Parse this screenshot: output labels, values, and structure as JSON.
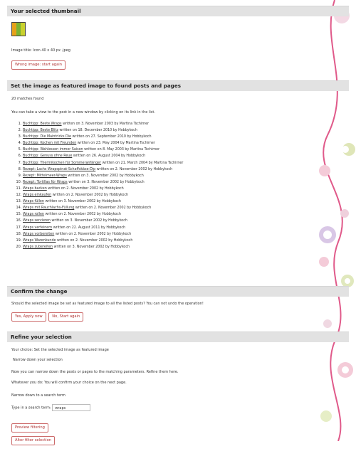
{
  "sections": {
    "thumbnail": {
      "title": "Your selected thumbnail",
      "image_title": "Image title: Icon 40 x 40 px .jpeg",
      "wrong_image_button": "Wrong image: start again"
    },
    "featured": {
      "title": "Set the image as featured image to found posts and pages",
      "matches": "20 matches found",
      "hint": "You can take a view to the post in a new window by clicking on its link in the list.",
      "posts": [
        {
          "link": "Buchtipp: Beste Wraps",
          "meta": "written on 3. November 2003 by Martina Tschirner"
        },
        {
          "link": "Buchtipp: Beste Blitz",
          "meta": "written on 18. December 2010 by Hobbykoch"
        },
        {
          "link": "Buchtipp: Die Maintricks Die",
          "meta": "written on 27. September 2010 by Hobbykoch"
        },
        {
          "link": "Buchtipp: Kochen mit Freunden",
          "meta": "written on 23. May 2004 by Martina Tschirner"
        },
        {
          "link": "Buchtipp: Wahlessen immer Saison",
          "meta": "written on 8. May 2003 by Martina Tschirner"
        },
        {
          "link": "Buchtipp: Genuss ohne Reue",
          "meta": "written on 26. August 2004 by Hobbykoch"
        },
        {
          "link": "Buchtipp: Thermikochen für Sommeranfänger",
          "meta": "written on 21. March 2004 by Martina Tschirner"
        },
        {
          "link": "Rezept: Lachs Wrapspinat-Schaffskäse-Dip",
          "meta": "written on 2. November 2002 by Hobbykoch"
        },
        {
          "link": "Rezept: Mittelmeer-Wraps",
          "meta": "written on 3. November 2002 by Hobbykoch"
        },
        {
          "link": "Rezept: Tortillas für Wraps",
          "meta": "written on 3. November 2002 by Hobbykoch"
        },
        {
          "link": "Wraps backen",
          "meta": "written on 2. November 2002 by Hobbykoch"
        },
        {
          "link": "Wraps einkaufen",
          "meta": "written on 2. November 2002 by Hobbykoch"
        },
        {
          "link": "Wraps füllen",
          "meta": "written on 3. November 2002 by Hobbykoch"
        },
        {
          "link": "Wraps mit Rauchlachs-Füllung",
          "meta": "written on 2. November 2002 by Hobbykoch"
        },
        {
          "link": "Wraps rollen",
          "meta": "written on 2. November 2002 by Hobbykoch"
        },
        {
          "link": "Wraps servieren",
          "meta": "written on 3. November 2002 by Hobbykoch"
        },
        {
          "link": "Wraps verfeinern",
          "meta": "written on 22. August 2011 by Hobbykoch"
        },
        {
          "link": "Wraps vorbereiten",
          "meta": "written on 2. November 2002 by Hobbykoch"
        },
        {
          "link": "Wraps Warenkunde",
          "meta": "written on 2. November 2002 by Hobbykoch"
        },
        {
          "link": "Wraps zubereiten",
          "meta": "written on 3. November 2002 by Hobbykoch"
        }
      ]
    },
    "confirm": {
      "title": "Confirm the change",
      "question": "Should the selected image be set as featured image to all the listed posts? You can not undo the operation!",
      "yes_button": "Yes, Apply now",
      "no_button": "No, Start again"
    },
    "refine": {
      "title": "Refine your selection",
      "choice": "Your choice: Set the selected image as featured image",
      "narrow_heading": "Narrow down your selection",
      "narrow_hint": "Now you can narrow down the posts or pages to the matching parameters. Refine them here.",
      "confirm_hint": "Whatever you do: You will confirm your choice on the next page.",
      "search_heading": "Narrow down to a search term",
      "search_label": "Type in a search term:",
      "search_value": "wraps",
      "preview_button": "Preview filtering",
      "alter_button": "Alter filter selection"
    }
  },
  "colors": {
    "header_bg": "#e2e2e2",
    "button_border": "#cc6a6a",
    "button_text": "#b03030"
  }
}
